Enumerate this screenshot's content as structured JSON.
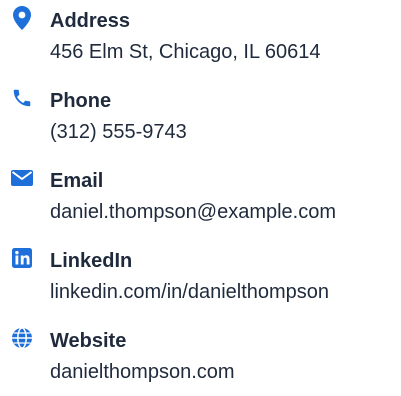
{
  "colors": {
    "accent": "#1e6fd9",
    "text": "#1f2a3c"
  },
  "contact": [
    {
      "icon": "map-pin-icon",
      "label": "Address",
      "value": "456 Elm St, Chicago, IL 60614"
    },
    {
      "icon": "phone-icon",
      "label": "Phone",
      "value": "(312) 555-9743"
    },
    {
      "icon": "envelope-icon",
      "label": "Email",
      "value": "daniel.thompson@example.com"
    },
    {
      "icon": "linkedin-icon",
      "label": "LinkedIn",
      "value": "linkedin.com/in/danielthompson"
    },
    {
      "icon": "globe-icon",
      "label": "Website",
      "value": "danielthompson.com"
    }
  ]
}
